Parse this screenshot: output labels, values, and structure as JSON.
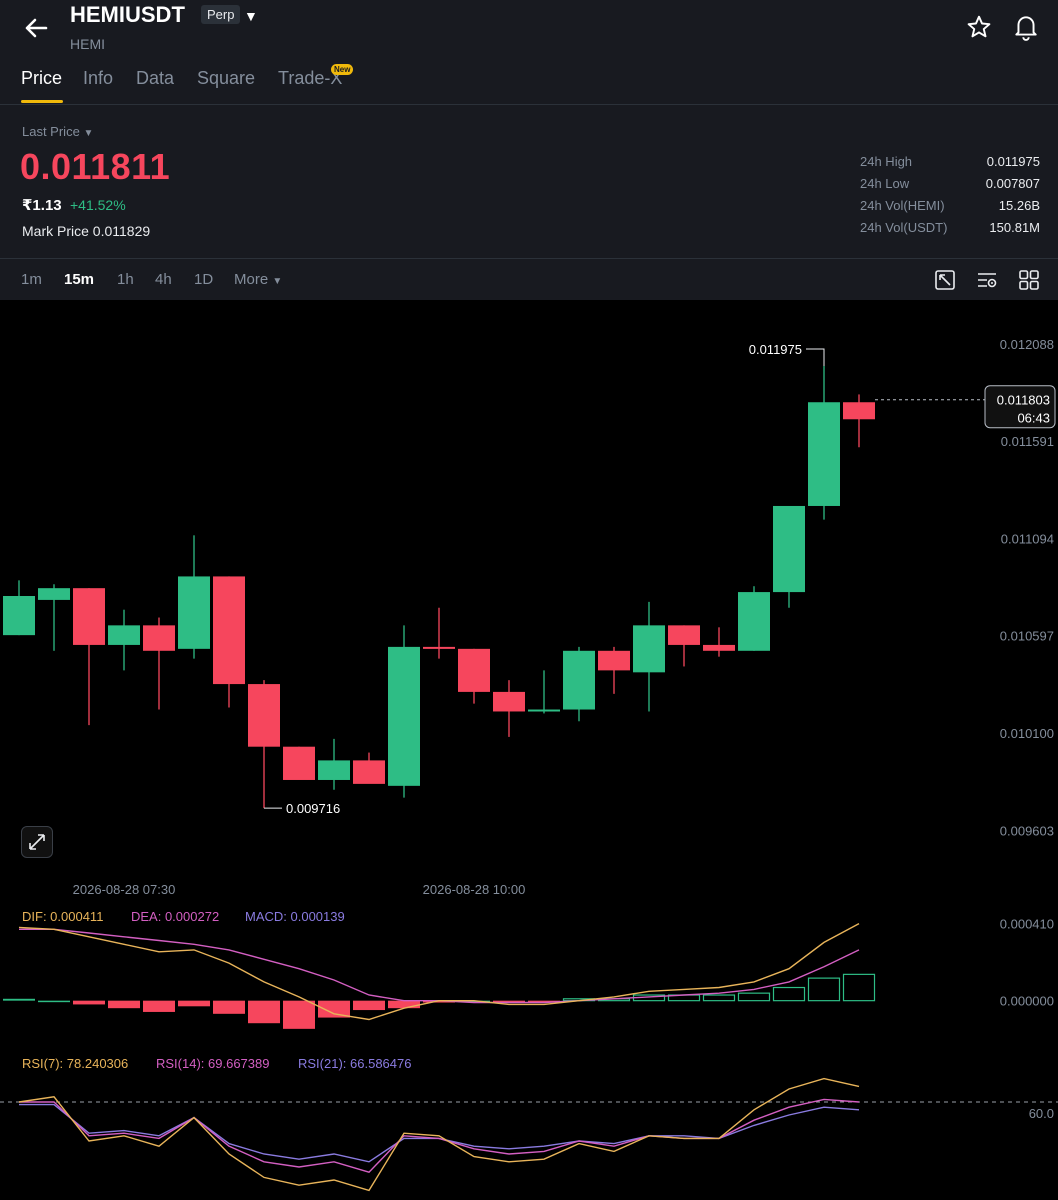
{
  "header": {
    "symbol": "HEMIUSDT",
    "contract_type": "Perp",
    "base_asset": "HEMI",
    "icons": [
      "back-arrow-icon",
      "caret-down-icon",
      "star-icon",
      "bell-icon"
    ]
  },
  "tabs": [
    {
      "label": "Price",
      "active": true
    },
    {
      "label": "Info"
    },
    {
      "label": "Data"
    },
    {
      "label": "Square"
    },
    {
      "label": "Trade-X",
      "badge": "New"
    }
  ],
  "ticker": {
    "last_price_label": "Last Price",
    "last_price": "0.011811",
    "fiat_price": "₹1.13",
    "change_pct": "+41.52%",
    "mark_price_label": "Mark Price",
    "mark_price": "0.011829",
    "stats": [
      {
        "label": "24h High",
        "value": "0.011975"
      },
      {
        "label": "24h Low",
        "value": "0.007807"
      },
      {
        "label": "24h Vol(HEMI)",
        "value": "15.26B"
      },
      {
        "label": "24h Vol(USDT)",
        "value": "150.81M"
      }
    ]
  },
  "intervals": {
    "items": [
      "1m",
      "15m",
      "1h",
      "4h",
      "1D"
    ],
    "active": "15m",
    "more_label": "More",
    "tool_icons": [
      "chart-style-icon",
      "indicator-settings-icon",
      "grid-layout-icon"
    ]
  },
  "colors": {
    "up": "#2ebd85",
    "down": "#f6465d",
    "background": "#000000",
    "panel": "#181a20",
    "accent": "#f0b90b",
    "dif": "#e8b45a",
    "dea": "#d35fc2",
    "macd": "#8a7be0",
    "rsi7": "#e8b45a",
    "rsi14": "#d35fc2",
    "rsi21": "#8a7be0"
  },
  "chart_data": [
    {
      "type": "candlestick",
      "interval": "15m",
      "y_ticks": [
        "0.012088",
        "0.011591",
        "0.011094",
        "0.010597",
        "0.010100",
        "0.009603"
      ],
      "ylim": [
        0.0094,
        0.0122
      ],
      "x_tick_labels": [
        "2026-08-28 07:30",
        "2026-08-28 10:00"
      ],
      "max_label": "0.011975",
      "min_label": "0.009716",
      "current_price": "0.011803",
      "countdown": "06:43",
      "candles": [
        {
          "o": 0.0106,
          "h": 0.01088,
          "l": 0.0106,
          "c": 0.0108
        },
        {
          "o": 0.01078,
          "h": 0.01086,
          "l": 0.01052,
          "c": 0.01084
        },
        {
          "o": 0.01084,
          "h": 0.01084,
          "l": 0.01014,
          "c": 0.01055
        },
        {
          "o": 0.01055,
          "h": 0.01073,
          "l": 0.01042,
          "c": 0.01065
        },
        {
          "o": 0.01065,
          "h": 0.01069,
          "l": 0.01022,
          "c": 0.01052
        },
        {
          "o": 0.01053,
          "h": 0.01111,
          "l": 0.01048,
          "c": 0.0109
        },
        {
          "o": 0.0109,
          "h": 0.0109,
          "l": 0.01023,
          "c": 0.01035
        },
        {
          "o": 0.01035,
          "h": 0.01037,
          "l": 0.009716,
          "c": 0.01003
        },
        {
          "o": 0.01003,
          "h": 0.01003,
          "l": 0.0099,
          "c": 0.00986
        },
        {
          "o": 0.00986,
          "h": 0.01007,
          "l": 0.00981,
          "c": 0.00996
        },
        {
          "o": 0.00996,
          "h": 0.01,
          "l": 0.00987,
          "c": 0.00984
        },
        {
          "o": 0.00983,
          "h": 0.01065,
          "l": 0.00977,
          "c": 0.01054
        },
        {
          "o": 0.01054,
          "h": 0.01074,
          "l": 0.01048,
          "c": 0.01053
        },
        {
          "o": 0.01053,
          "h": 0.01053,
          "l": 0.01025,
          "c": 0.01031
        },
        {
          "o": 0.01031,
          "h": 0.01037,
          "l": 0.01008,
          "c": 0.01021
        },
        {
          "o": 0.01021,
          "h": 0.01042,
          "l": 0.0102,
          "c": 0.01022
        },
        {
          "o": 0.01022,
          "h": 0.01054,
          "l": 0.01016,
          "c": 0.01052
        },
        {
          "o": 0.01052,
          "h": 0.01054,
          "l": 0.0103,
          "c": 0.01042
        },
        {
          "o": 0.01041,
          "h": 0.01077,
          "l": 0.01021,
          "c": 0.01065
        },
        {
          "o": 0.01065,
          "h": 0.01065,
          "l": 0.01044,
          "c": 0.01055
        },
        {
          "o": 0.01055,
          "h": 0.01064,
          "l": 0.01049,
          "c": 0.01052
        },
        {
          "o": 0.01052,
          "h": 0.01085,
          "l": 0.01052,
          "c": 0.01082
        },
        {
          "o": 0.01082,
          "h": 0.01123,
          "l": 0.01074,
          "c": 0.01126
        },
        {
          "o": 0.01126,
          "h": 0.011975,
          "l": 0.01119,
          "c": 0.01179
        },
        {
          "o": 0.01179,
          "h": 0.01183,
          "l": 0.01156,
          "c": 0.011703
        }
      ]
    },
    {
      "type": "macd",
      "dif_label": "DIF: 0.000411",
      "dea_label": "DEA: 0.000272",
      "macd_label": "MACD: 0.000139",
      "y_ticks": [
        "0.000410",
        "0.000000"
      ],
      "ylim": [
        -0.00022,
        0.00044
      ],
      "dif": [
        0.00039,
        0.00038,
        0.00034,
        0.0003,
        0.00026,
        0.00027,
        0.0002,
        0.0001,
        2e-05,
        -7e-05,
        -0.0001,
        -4e-05,
        0.0,
        0.0,
        -2e-05,
        -2e-05,
        0.0,
        2e-05,
        5e-05,
        6e-05,
        7e-05,
        0.0001,
        0.00017,
        0.00031,
        0.00041
      ],
      "dea": [
        0.00038,
        0.00038,
        0.00036,
        0.00034,
        0.00032,
        0.0003,
        0.00027,
        0.00022,
        0.00017,
        0.00011,
        3e-05,
        0.0,
        0.0,
        -1e-05,
        -1e-05,
        -1e-05,
        0.0,
        1e-05,
        2e-05,
        3e-05,
        4e-05,
        6e-05,
        0.0001,
        0.00018,
        0.00027
      ],
      "hist": [
        1e-05,
        0.0,
        -2e-05,
        -4e-05,
        -6e-05,
        -3e-05,
        -7e-05,
        -0.00012,
        -0.00015,
        -9e-05,
        -5e-05,
        -4e-05,
        -1e-05,
        0.0,
        -1e-05,
        -1e-05,
        1e-05,
        1e-05,
        3e-05,
        3e-05,
        3e-05,
        4e-05,
        7e-05,
        0.00012,
        0.00014
      ]
    },
    {
      "type": "rsi",
      "rsi7_label": "RSI(7): 78.240306",
      "rsi14_label": "RSI(14): 69.667389",
      "rsi21_label": "RSI(21): 66.586476",
      "y_ticks": [
        "60.0"
      ],
      "ylim": [
        35,
        80
      ],
      "reference_level": 70,
      "rsi7": [
        70,
        72,
        55,
        57,
        53,
        64,
        50,
        41,
        38,
        40,
        36,
        58,
        57,
        49,
        47,
        48,
        54,
        51,
        57,
        56,
        56,
        67,
        75,
        79,
        76
      ],
      "rsi14": [
        70,
        70,
        57,
        58,
        56,
        64,
        53,
        47,
        45,
        47,
        43,
        57,
        56,
        52,
        50,
        51,
        55,
        53,
        57,
        56,
        56,
        63,
        68,
        71,
        70
      ],
      "rsi21": [
        69,
        69,
        58,
        59,
        57,
        64,
        54,
        50,
        48,
        50,
        47,
        56,
        56,
        53,
        52,
        53,
        55,
        54,
        57,
        57,
        56,
        61,
        65,
        68,
        67
      ]
    }
  ]
}
